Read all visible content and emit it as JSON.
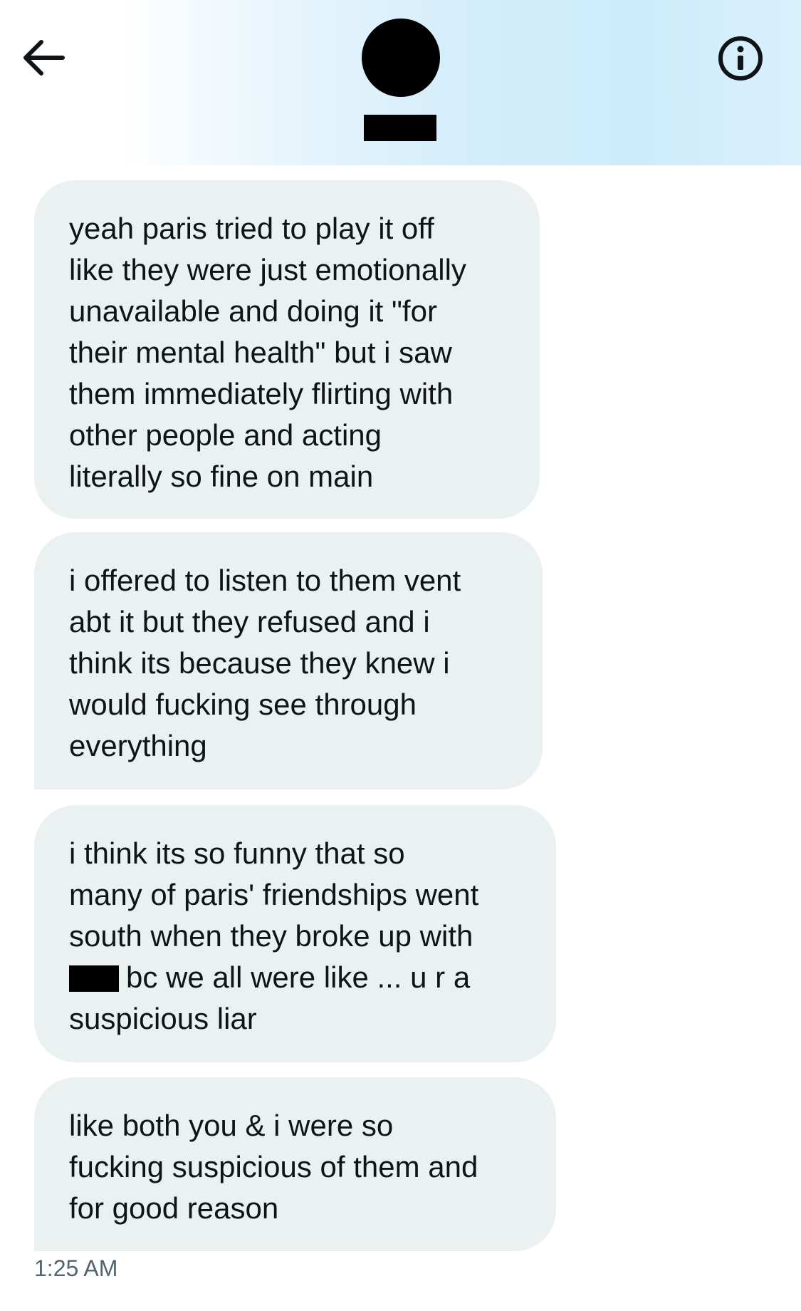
{
  "header": {
    "back_icon": "arrow-left-icon",
    "info_icon": "info-circle-icon",
    "avatar": "redacted-avatar",
    "name": ""
  },
  "messages": [
    {
      "text": "yeah paris tried to play it off\nlike they were just emotionally\nunavailable and doing it \"for\ntheir mental health\" but i saw\nthem immediately flirting with\nother people and acting\nliterally so fine on main"
    },
    {
      "text": "i offered to listen to them vent\nabt it but they refused and i\nthink its because they knew i\nwould fucking see through\neverything"
    },
    {
      "text_before": "i think its so funny that so\nmany of paris' friendships went\nsouth when they broke up with\n",
      "text_after": "bc we all were like ... u r a\nsuspicious liar"
    },
    {
      "text": "like both you & i were so\nfucking suspicious of them and\nfor good reason"
    }
  ],
  "timestamp": "1:25 AM",
  "colors": {
    "bubble_bg": "#ebf0f1",
    "text": "#0f1419",
    "timestamp": "#536471",
    "header_gradient_accent": "#cdebfb"
  }
}
